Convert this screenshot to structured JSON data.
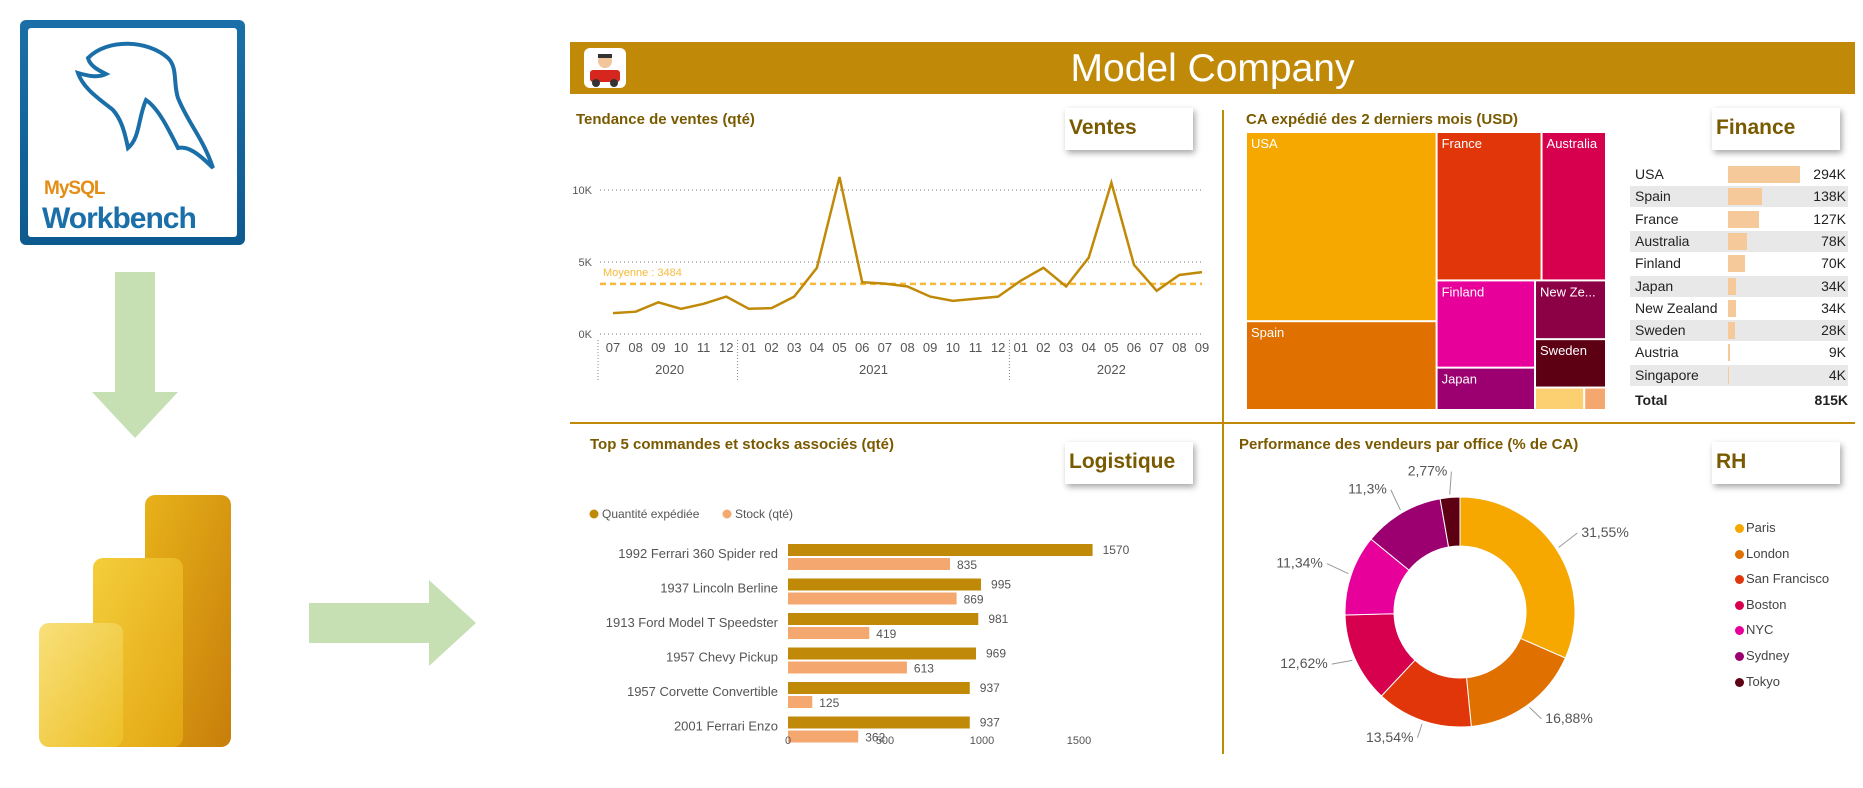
{
  "logos": {
    "mysql": {
      "line1": "MySQL",
      "line2": "Workbench"
    },
    "powerbi": {
      "icon": "powerbi-icon"
    }
  },
  "dashboard": {
    "title": "Model Company",
    "icon": "car-mascot-icon",
    "colors": {
      "accent": "#c08a08"
    }
  },
  "ventes": {
    "badge": "Ventes",
    "title": "Tendance de ventes (qté)",
    "average_label": "Moyenne : 3484"
  },
  "finance": {
    "badge": "Finance",
    "title": "CA expédié des 2 derniers mois (USD)",
    "table": {
      "rows": [
        {
          "country": "USA",
          "value": "294K",
          "num": 294
        },
        {
          "country": "Spain",
          "value": "138K",
          "num": 138
        },
        {
          "country": "France",
          "value": "127K",
          "num": 127
        },
        {
          "country": "Australia",
          "value": "78K",
          "num": 78
        },
        {
          "country": "Finland",
          "value": "70K",
          "num": 70
        },
        {
          "country": "Japan",
          "value": "34K",
          "num": 34
        },
        {
          "country": "New Zealand",
          "value": "34K",
          "num": 34
        },
        {
          "country": "Sweden",
          "value": "28K",
          "num": 28
        },
        {
          "country": "Austria",
          "value": "9K",
          "num": 9
        },
        {
          "country": "Singapore",
          "value": "4K",
          "num": 4
        }
      ],
      "total_label": "Total",
      "total_value": "815K"
    }
  },
  "logistique": {
    "badge": "Logistique",
    "title": "Top 5 commandes et stocks associés (qté)"
  },
  "rh": {
    "badge": "RH",
    "title": "Performance des vendeurs par office (% de CA)"
  },
  "chart_data": [
    {
      "type": "line",
      "title": "Tendance de ventes (qté)",
      "x": [
        "07",
        "08",
        "09",
        "10",
        "11",
        "12",
        "01",
        "02",
        "03",
        "04",
        "05",
        "06",
        "07",
        "08",
        "09",
        "10",
        "11",
        "12",
        "01",
        "02",
        "03",
        "04",
        "05",
        "06",
        "07",
        "08",
        "09"
      ],
      "year_groups": [
        {
          "label": "2020"
        },
        {
          "label": "2021"
        },
        {
          "label": "2022"
        }
      ],
      "series": [
        {
          "values": [
            1450,
            1550,
            2200,
            1750,
            2100,
            2600,
            1750,
            1800,
            2600,
            4600,
            10900,
            3600,
            3500,
            3300,
            2600,
            2300,
            2450,
            2600,
            3700,
            4600,
            3300,
            5300,
            10500,
            4800,
            3000,
            4100,
            4300
          ]
        }
      ],
      "average": 3484,
      "yticks": [
        "0K",
        "5K",
        "10K"
      ],
      "ylim": [
        0,
        12000
      ],
      "color": "#c08a08",
      "average_color": "#f6b93b"
    },
    {
      "type": "treemap",
      "title": "CA expédié des 2 derniers mois (USD)",
      "items": [
        {
          "label": "USA",
          "value": 294,
          "color": "#f6a800"
        },
        {
          "label": "Spain",
          "value": 138,
          "color": "#e07000"
        },
        {
          "label": "France",
          "value": 127,
          "color": "#e0360a"
        },
        {
          "label": "Australia",
          "value": 78,
          "color": "#d6004e"
        },
        {
          "label": "Finland",
          "value": 70,
          "color": "#e8009a"
        },
        {
          "label": "New Ze...",
          "value": 34,
          "color": "#8c0046"
        },
        {
          "label": "Japan",
          "value": 34,
          "color": "#9c0070"
        },
        {
          "label": "Sweden",
          "value": 28,
          "color": "#5e0014"
        },
        {
          "label": "",
          "value": 9,
          "color": "#fcd070"
        },
        {
          "label": "",
          "value": 4,
          "color": "#f4a870"
        }
      ]
    },
    {
      "type": "bar",
      "title": "Top 5 commandes et stocks associés (qté)",
      "categories": [
        "1992 Ferrari 360 Spider red",
        "1937 Lincoln Berline",
        "1913 Ford Model T Speedster",
        "1957 Chevy Pickup",
        "1957 Corvette Convertible",
        "2001 Ferrari Enzo"
      ],
      "series": [
        {
          "name": "Quantité expédiée",
          "values": [
            1570,
            995,
            981,
            969,
            937,
            937
          ],
          "color": "#c08a08"
        },
        {
          "name": "Stock (qté)",
          "values": [
            835,
            869,
            419,
            613,
            125,
            362
          ],
          "color": "#f4a870"
        }
      ],
      "xticks": [
        "0",
        "500",
        "1000",
        "1500"
      ],
      "xlim": [
        0,
        1800
      ]
    },
    {
      "type": "pie",
      "title": "Performance des vendeurs par office (% de CA)",
      "slices": [
        {
          "name": "Paris",
          "value": 31.55,
          "label": "31,55%",
          "color": "#f6a800"
        },
        {
          "name": "London",
          "value": 16.88,
          "label": "16,88%",
          "color": "#e07000"
        },
        {
          "name": "San Francisco",
          "value": 13.54,
          "label": "13,54%",
          "color": "#e0360a"
        },
        {
          "name": "Boston",
          "value": 12.62,
          "label": "12,62%",
          "color": "#d6004e"
        },
        {
          "name": "NYC",
          "value": 11.34,
          "label": "11,34%",
          "color": "#e8009a"
        },
        {
          "name": "Sydney",
          "value": 11.3,
          "label": "11,3%",
          "color": "#9c0070"
        },
        {
          "name": "Tokyo",
          "value": 2.77,
          "label": "2,77%",
          "color": "#5e0014"
        }
      ],
      "legend_placement": "right"
    }
  ]
}
